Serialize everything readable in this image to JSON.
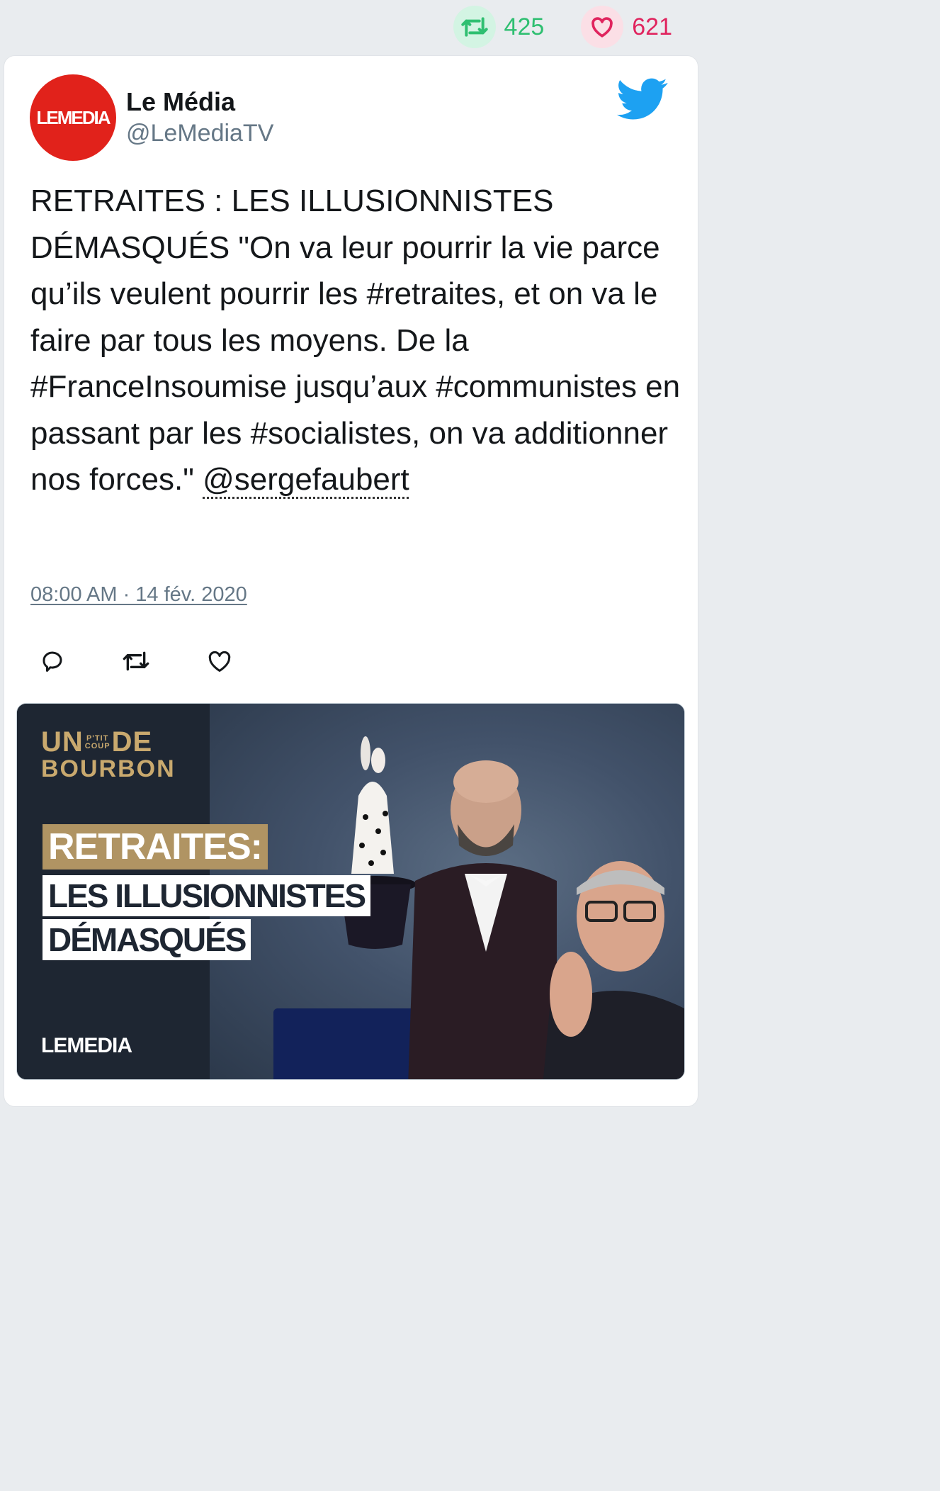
{
  "stats": {
    "retweets": "425",
    "likes": "621"
  },
  "author": {
    "name": "Le Média",
    "handle": "@LeMediaTV",
    "avatar_logo": "LEMEDIA"
  },
  "tweet": {
    "text_before_mention": "RETRAITES : LES ILLUSIONNISTES DÉMASQUÉS \"On va leur pourrir la vie parce qu’ils veulent pourrir les #retraites, et on va le faire par tous les moyens. De la #FranceInsoumise jusqu’aux #communistes en passant par les #socialistes, on va additionner nos forces.\" ",
    "mention": "@sergefaubert",
    "timestamp": "08:00 AM · 14 fév. 2020"
  },
  "media": {
    "logo_line1_a": "UN",
    "logo_small_top": "P'TIT",
    "logo_small_bottom": "COUP",
    "logo_line1_b": "DE",
    "logo_line2": "BOURBON",
    "band1": "RETRAITES:",
    "band2": "LES ILLUSIONNISTES",
    "band3": "DÉMASQUÉS",
    "brand": "LEMEDIA"
  },
  "icons": [
    "retweet-icon",
    "heart-icon",
    "twitter-bird-icon",
    "reply-icon",
    "retweet-action-icon",
    "like-action-icon"
  ],
  "colors": {
    "retweet": "#2fbf71",
    "like": "#e0245e",
    "twitter_blue": "#1da1f2",
    "avatar_red": "#e1221b",
    "gold": "#b09463"
  }
}
